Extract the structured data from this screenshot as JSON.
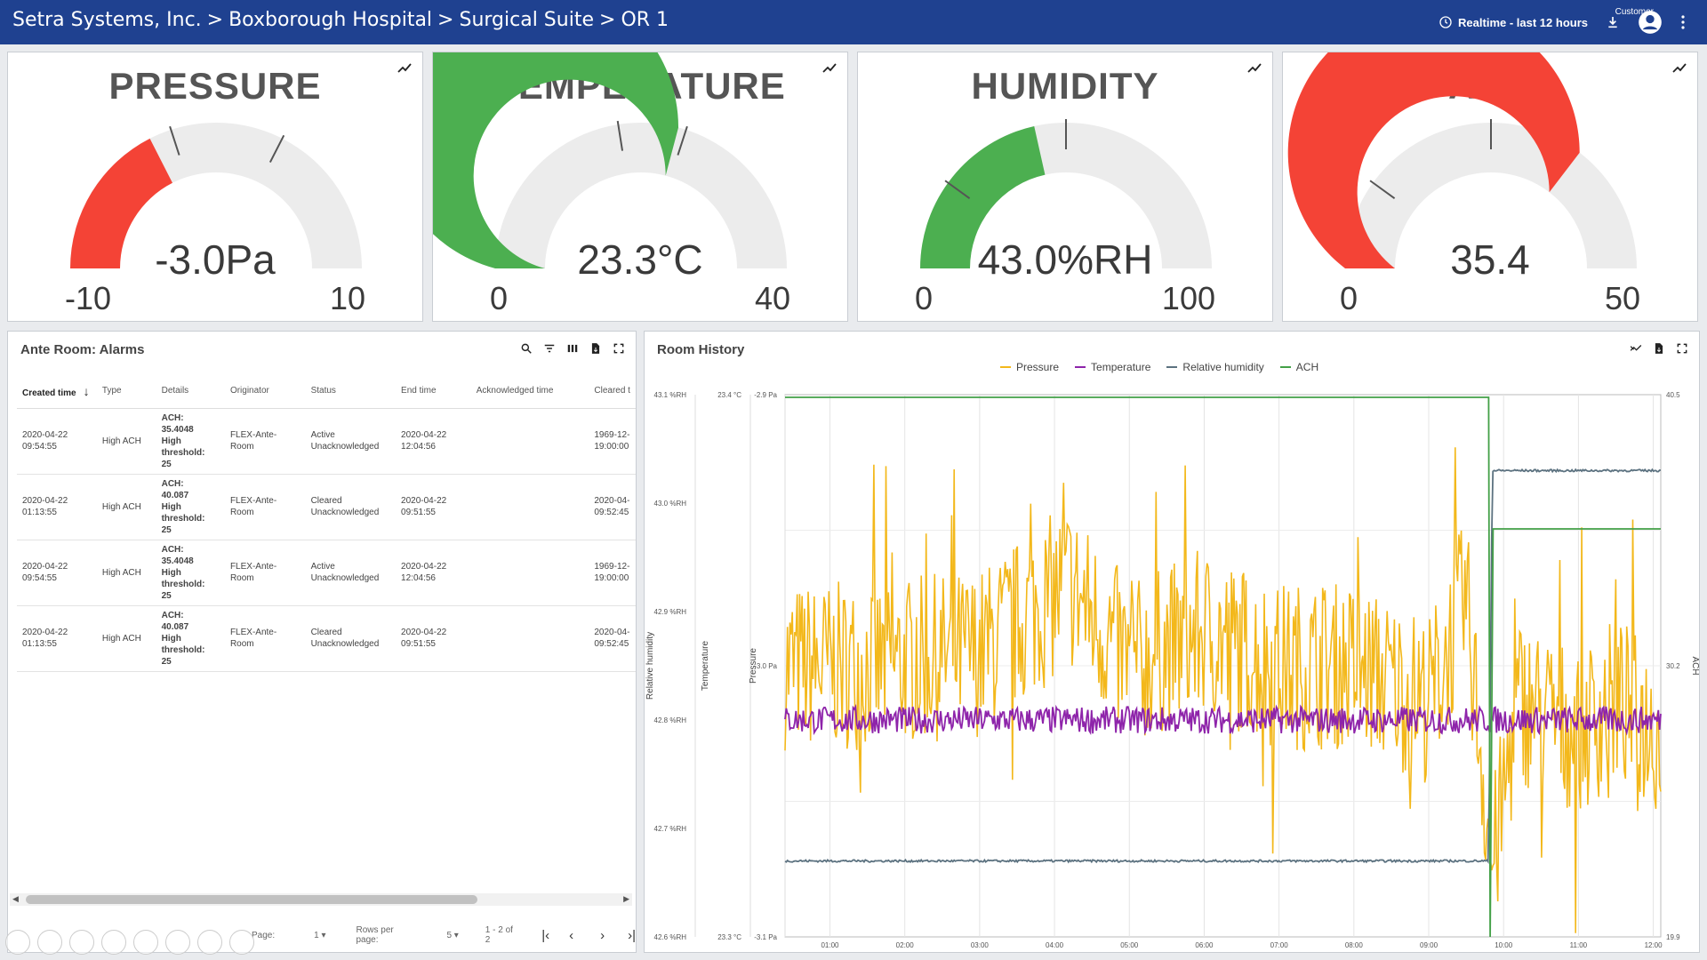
{
  "header": {
    "breadcrumb": [
      "Setra Systems, Inc.",
      "Boxborough Hospital",
      "Surgical Suite",
      "OR 1"
    ],
    "separator": ">",
    "timewindow_label": "Realtime - last 12 hours",
    "user_label": "Customer",
    "icons": [
      "clock-icon",
      "download-icon",
      "account-icon",
      "more-vert-icon"
    ]
  },
  "gauges": [
    {
      "title": "PRESSURE",
      "value_text": "-3.0Pa",
      "min_label": "-10",
      "max_label": "10",
      "min": -10,
      "max": 10,
      "value": -3.0,
      "bar_color": "#f44336",
      "ticks": [
        -2,
        3
      ]
    },
    {
      "title": "TEMPERATURE",
      "value_text": "23.3°C",
      "min_label": "0",
      "max_label": "40",
      "min": 0,
      "max": 40,
      "value": 23.3,
      "bar_color": "#4caf50",
      "ticks": [
        18,
        24
      ]
    },
    {
      "title": "HUMIDITY",
      "value_text": "43.0%RH",
      "min_label": "0",
      "max_label": "100",
      "min": 0,
      "max": 100,
      "value": 43.0,
      "bar_color": "#4caf50",
      "ticks": [
        20,
        50
      ]
    },
    {
      "title": "ACH",
      "value_text": "35.4",
      "min_label": "0",
      "max_label": "50",
      "min": 0,
      "max": 50,
      "value": 35.4,
      "bar_color": "#f44336",
      "ticks": [
        10,
        25
      ]
    }
  ],
  "alarms": {
    "title": "Ante Room: Alarms",
    "columns": [
      "Created time",
      "Type",
      "Details",
      "Originator",
      "Status",
      "End time",
      "Acknowledged time",
      "Cleared t"
    ],
    "rows": [
      {
        "created": "2020-04-22\n09:54:55",
        "type": "High ACH",
        "details": "ACH:\n35.4048\nHigh\nthreshold:\n25",
        "originator": "FLEX-Ante-\nRoom",
        "status": "Active\nUnacknowledged",
        "end": "2020-04-22\n12:04:56",
        "ack": "",
        "cleared": "1969-12-\n19:00:00"
      },
      {
        "created": "2020-04-22\n01:13:55",
        "type": "High ACH",
        "details": "ACH:\n40.087\nHigh\nthreshold:\n25",
        "originator": "FLEX-Ante-\nRoom",
        "status": "Cleared\nUnacknowledged",
        "end": "2020-04-22\n09:51:55",
        "ack": "",
        "cleared": "2020-04-\n09:52:45"
      },
      {
        "created": "2020-04-22\n09:54:55",
        "type": "High ACH",
        "details": "ACH:\n35.4048\nHigh\nthreshold:\n25",
        "originator": "FLEX-Ante-\nRoom",
        "status": "Active\nUnacknowledged",
        "end": "2020-04-22\n12:04:56",
        "ack": "",
        "cleared": "1969-12-\n19:00:00"
      },
      {
        "created": "2020-04-22\n01:13:55",
        "type": "High ACH",
        "details": "ACH:\n40.087\nHigh\nthreshold:\n25",
        "originator": "FLEX-Ante-\nRoom",
        "status": "Cleared\nUnacknowledged",
        "end": "2020-04-22\n09:51:55",
        "ack": "",
        "cleared": "2020-04-\n09:52:45"
      }
    ],
    "pager": {
      "page_label": "Page:",
      "page": "1",
      "rows_label": "Rows per page:",
      "rows": "5",
      "range": "1 - 2 of 2"
    }
  },
  "history": {
    "title": "Room History",
    "chart_data": {
      "type": "line",
      "x_ticks": [
        "01:00",
        "02:00",
        "03:00",
        "04:00",
        "05:00",
        "06:00",
        "07:00",
        "08:00",
        "09:00",
        "10:00",
        "11:00",
        "12:00"
      ],
      "x_range": [
        0.4,
        12.1
      ],
      "series": [
        {
          "name": "Pressure",
          "color": "#f3b81b",
          "axis": "pressure",
          "baseline": -3.0,
          "noise": 0.25,
          "points": [
            [
              0.4,
              -3.0
            ],
            [
              1.5,
              -3.0
            ],
            [
              3.0,
              -2.98
            ],
            [
              4.2,
              -2.88
            ],
            [
              5.0,
              -3.0
            ],
            [
              6.0,
              -2.95
            ],
            [
              7.0,
              -3.0
            ],
            [
              8.0,
              -3.0
            ],
            [
              9.0,
              -3.05
            ],
            [
              9.5,
              -2.9
            ],
            [
              9.85,
              -3.3
            ],
            [
              10.2,
              -3.05
            ],
            [
              11.0,
              -3.1
            ],
            [
              11.5,
              -3.05
            ],
            [
              12.1,
              -3.1
            ]
          ]
        },
        {
          "name": "Temperature",
          "color": "#8e24aa",
          "axis": "temperature",
          "baseline": 23.22,
          "noise": 0.015,
          "points": [
            [
              0.4,
              23.22
            ],
            [
              12.1,
              23.22
            ]
          ]
        },
        {
          "name": "Relative humidity",
          "color": "#5c7280",
          "axis": "humidity",
          "baseline": 42.68,
          "noise": 0.002,
          "points": [
            [
              0.4,
              42.67
            ],
            [
              9.8,
              42.67
            ],
            [
              9.85,
              43.03
            ],
            [
              12.1,
              43.03
            ]
          ]
        },
        {
          "name": "ACH",
          "color": "#43a047",
          "axis": "ach",
          "baseline": 40.4,
          "noise": 0,
          "points": [
            [
              0.4,
              40.4
            ],
            [
              9.8,
              40.4
            ],
            [
              9.82,
              19.9
            ],
            [
              9.86,
              35.4
            ],
            [
              12.1,
              35.4
            ]
          ]
        }
      ],
      "axes": {
        "humidity": {
          "title": "Relative humidity",
          "ticks": [
            "43.1 %RH",
            "43.0 %RH",
            "42.9 %RH",
            "42.8 %RH",
            "42.7 %RH",
            "42.6 %RH"
          ],
          "range": [
            42.6,
            43.1
          ]
        },
        "temperature": {
          "title": "Temperature",
          "ticks": [
            "23.4 °C",
            "23.3 °C"
          ],
          "range": [
            23.1,
            23.4
          ]
        },
        "pressure": {
          "title": "Pressure",
          "ticks": [
            "-2.9 Pa",
            "-3.0 Pa",
            "-3.1 Pa"
          ],
          "range": [
            -3.4,
            -2.6
          ]
        },
        "ach": {
          "title": "ACH",
          "ticks": [
            "40.5",
            "30.2",
            "19.9"
          ],
          "range": [
            19.9,
            40.5
          ]
        }
      },
      "legend_position": "top-center",
      "grid": true
    }
  }
}
